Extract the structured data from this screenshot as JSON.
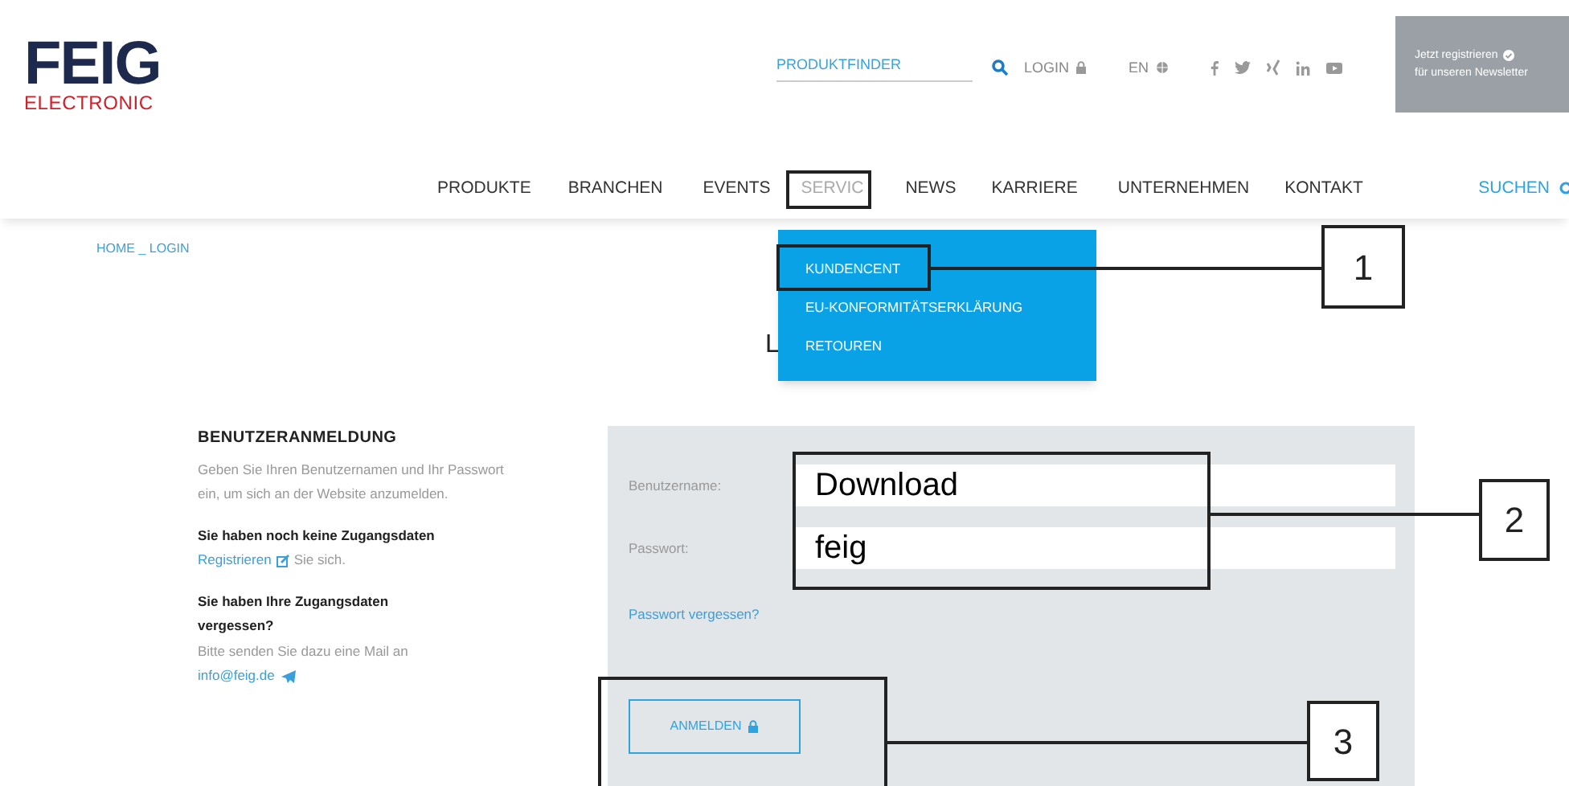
{
  "logo": {
    "name": "FEIG",
    "subtitle": "ELECTRONIC"
  },
  "utility": {
    "produktfinder": "PRODUKTFINDER",
    "login": "LOGIN",
    "language": "EN"
  },
  "newsletter": {
    "line_1": "Jetzt registrieren",
    "line_2": "für unseren Newsletter"
  },
  "nav": [
    {
      "label": "PRODUKTE",
      "selected": false
    },
    {
      "label": "BRANCHEN",
      "selected": false
    },
    {
      "label": "EVENTS",
      "selected": false
    },
    {
      "label": "SERVIC",
      "selected": true
    },
    {
      "label": "NEWS",
      "selected": false
    },
    {
      "label": "KARRIERE",
      "selected": false
    },
    {
      "label": "UNTERNEHMEN",
      "selected": false
    },
    {
      "label": "KONTAKT",
      "selected": false
    }
  ],
  "search_link": "SUCHEN",
  "breadcrumb": "HOME _ LOGIN",
  "page_title": "L",
  "dropdown": [
    {
      "label": "KUNDENCENT",
      "highlighted": true
    },
    {
      "label": "EU-KONFORMITÄTSERKLÄRUNG",
      "highlighted": false
    },
    {
      "label": "RETOUREN",
      "highlighted": false
    }
  ],
  "info": {
    "heading": "BENUTZERANMELDUNG",
    "intro": "Geben Sie Ihren Benutzernamen und Ihr Passwort ein, um sich an der Website anzumelden.",
    "no_account_heading": "Sie haben noch keine Zugangsdaten",
    "register_link": "Registrieren",
    "register_rest": "Sie sich.",
    "forgot_heading": "Sie haben Ihre Zugangsdaten vergessen?",
    "forgot_text": "Bitte senden Sie dazu eine Mail an",
    "email_link": "info@feig.de"
  },
  "form": {
    "fields": [
      {
        "label": "Benutzername:",
        "value": "Download"
      },
      {
        "label": "Passwort:",
        "value": "feig"
      }
    ],
    "forgot_link": "Passwort vergessen?",
    "submit": "ANMELDEN"
  },
  "callouts": [
    "1",
    "2",
    "3"
  ]
}
